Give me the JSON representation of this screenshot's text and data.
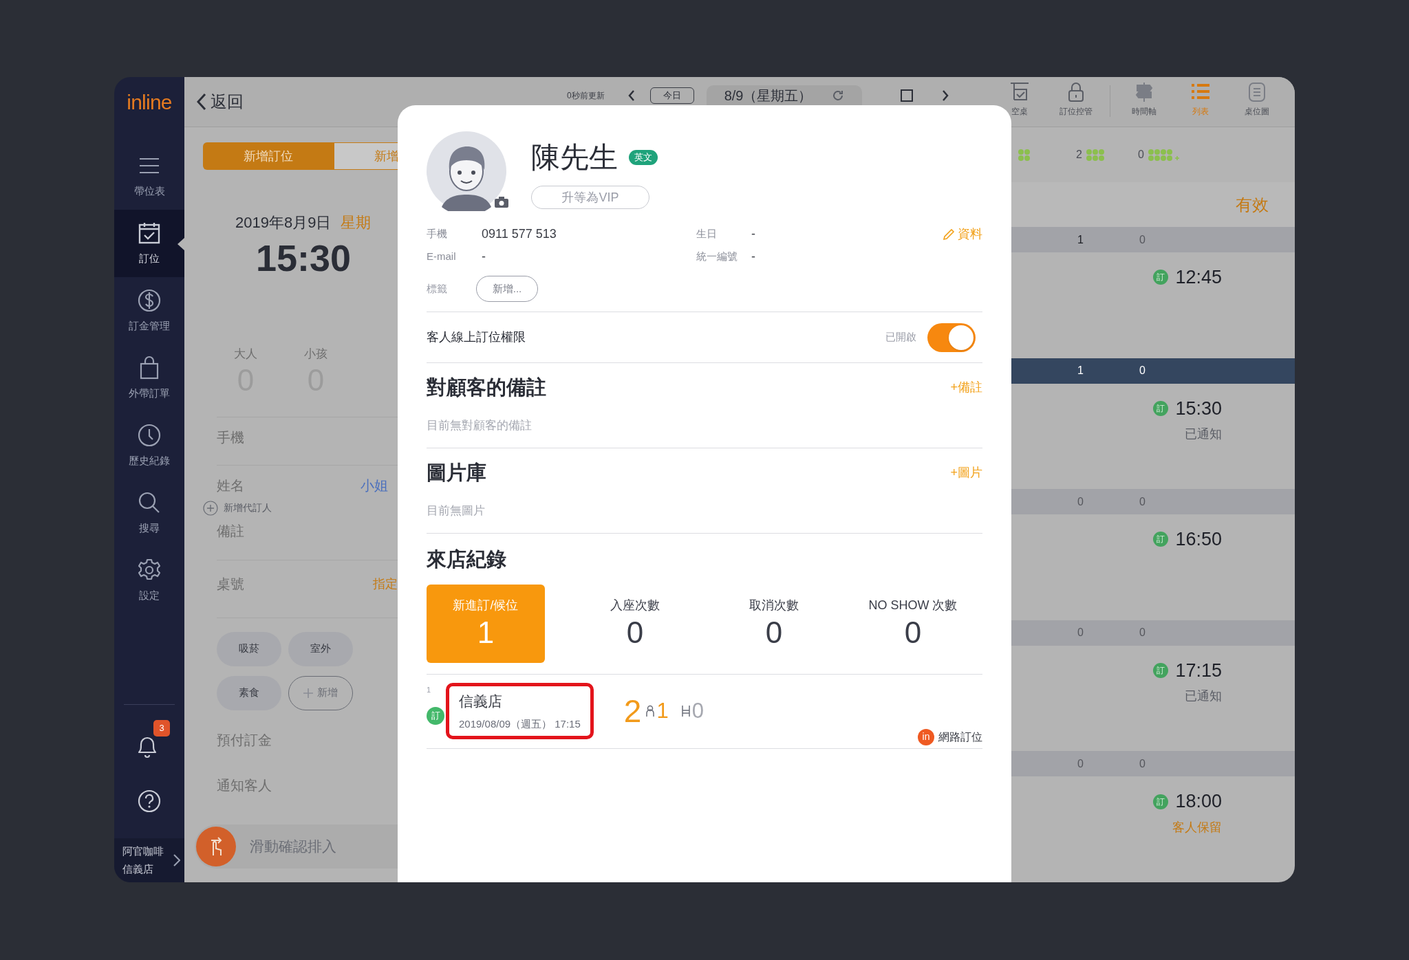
{
  "sidebar": {
    "logo": "inline",
    "items": [
      {
        "label": "帶位表",
        "selected": false
      },
      {
        "label": "訂位",
        "selected": true
      },
      {
        "label": "訂金管理",
        "selected": false
      },
      {
        "label": "外帶訂單",
        "selected": false
      },
      {
        "label": "歷史紀錄",
        "selected": false
      },
      {
        "label": "搜尋",
        "selected": false
      },
      {
        "label": "設定",
        "selected": false
      }
    ],
    "notification_badge": "3",
    "store": {
      "name": "阿官咖啡",
      "branch": "信義店"
    }
  },
  "top_bar": {
    "back": "返回",
    "updated": "0秒前更新",
    "today": "今日",
    "date": "8/9（星期五）",
    "tool_groups": [
      [
        {
          "label": "空桌",
          "selected": false
        },
        {
          "label": "訂位控管",
          "selected": false
        }
      ],
      [
        {
          "label": "時間軸",
          "selected": false
        },
        {
          "label": "列表",
          "selected": true
        },
        {
          "label": "桌位圖",
          "selected": false
        }
      ]
    ]
  },
  "left_panel": {
    "tabs": [
      {
        "label": "新增訂位",
        "selected": true
      },
      {
        "label": "新增",
        "selected": false
      }
    ],
    "date": "2019年8月9日",
    "weekday": "星期",
    "time": "15:30",
    "counts": [
      {
        "label": "大人",
        "value": "0"
      },
      {
        "label": "小孩",
        "value": "0"
      }
    ],
    "phone_label": "手機",
    "name_label": "姓名",
    "title_value": "小姐",
    "add_booker": "新增代訂人",
    "note_label": "備註",
    "table_label": "桌號",
    "table_action": "指定",
    "tag_rows": [
      [
        {
          "label": "吸菸",
          "kind": "tag"
        },
        {
          "label": "室外",
          "kind": "tag"
        }
      ],
      [
        {
          "label": "素食",
          "kind": "tag"
        },
        {
          "label": "新增",
          "kind": "add"
        }
      ]
    ],
    "deposit_label": "預付訂金",
    "notify_label": "通知客人",
    "slide_label": "滑動確認排入"
  },
  "modal": {
    "customer": {
      "name": "陳先生",
      "language": "英文",
      "vip_button": "升等為VIP"
    },
    "info": [
      {
        "label": "手機",
        "value": "0911 577 513"
      },
      {
        "label": "生日",
        "value": "-"
      },
      {
        "label": "E-mail",
        "value": "-"
      },
      {
        "label": "統一編號",
        "value": "-"
      }
    ],
    "edit": "資料",
    "tags_label": "標籤",
    "tags_add": "新增...",
    "online_permission": {
      "label": "客人線上訂位權限",
      "status": "已開啟",
      "on": true
    },
    "sections": [
      {
        "title": "對顧客的備註",
        "action": "+備註",
        "empty": "目前無對顧客的備註"
      },
      {
        "title": "圖片庫",
        "action": "+圖片",
        "empty": "目前無圖片"
      }
    ],
    "visits": {
      "title": "來店紀錄",
      "stats": [
        {
          "label": "新進訂/候位",
          "value": "1",
          "selected": true
        },
        {
          "label": "入座次數",
          "value": "0",
          "selected": false
        },
        {
          "label": "取消次數",
          "value": "0",
          "selected": false
        },
        {
          "label": "NO SHOW 次數",
          "value": "0",
          "selected": false
        }
      ],
      "records": [
        {
          "index": "1",
          "badge": "訂",
          "store": "信義店",
          "datetime": "2019/08/09（週五） 17:15",
          "highlighted": true,
          "party": "2",
          "adults": "1",
          "children": "0",
          "source_badge": "in",
          "source": "網路訂位"
        }
      ]
    }
  },
  "right_panel": {
    "summary": [
      {
        "kind": "small"
      },
      {
        "count": "2",
        "kind": "medium"
      },
      {
        "count": "0",
        "kind": "large"
      }
    ],
    "status": "有效",
    "slots": [
      {
        "selected": false,
        "counts": [
          {
            "value": "1",
            "muted": false
          },
          {
            "value": "0",
            "muted": true
          }
        ],
        "bookings": [
          {
            "badge": "訂",
            "time": "12:45"
          }
        ]
      },
      {
        "selected": true,
        "counts": [
          {
            "value": "1",
            "muted": false
          },
          {
            "value": "0",
            "muted": false
          }
        ],
        "bookings": [
          {
            "badge": "訂",
            "time": "15:30",
            "note": {
              "text": "已通知",
              "kind": "notified"
            }
          }
        ]
      },
      {
        "selected": false,
        "counts": [
          {
            "value": "0",
            "muted": true
          },
          {
            "value": "0",
            "muted": true
          }
        ],
        "bookings": [
          {
            "badge": "訂",
            "time": "16:50"
          }
        ]
      },
      {
        "selected": false,
        "counts": [
          {
            "value": "0",
            "muted": true
          },
          {
            "value": "0",
            "muted": true
          }
        ],
        "bookings": [
          {
            "badge": "訂",
            "time": "17:15",
            "note": {
              "text": "已通知",
              "kind": "notified"
            }
          }
        ]
      },
      {
        "selected": false,
        "counts": [
          {
            "value": "0",
            "muted": true
          },
          {
            "value": "0",
            "muted": true
          }
        ],
        "bookings": [
          {
            "badge": "訂",
            "time": "18:00",
            "note": {
              "text": "客人保留",
              "kind": "held"
            }
          }
        ]
      }
    ]
  }
}
